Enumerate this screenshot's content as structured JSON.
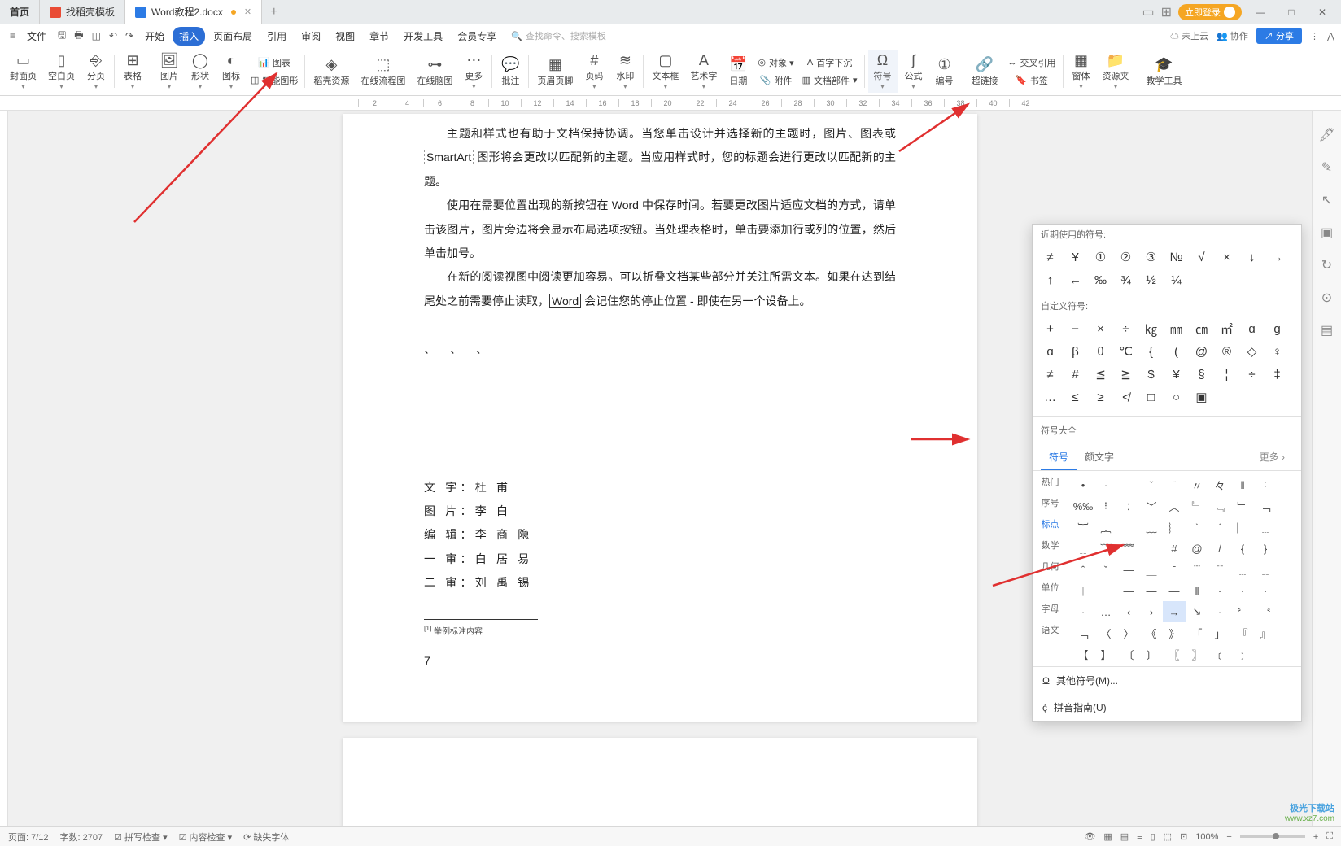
{
  "tabs": {
    "home": "首页",
    "template": "找稻壳模板",
    "doc": "Word教程2.docx"
  },
  "titlebar_right": {
    "login": "立即登录"
  },
  "menubar": {
    "file": "文件",
    "items": [
      "开始",
      "插入",
      "页面布局",
      "引用",
      "审阅",
      "视图",
      "章节",
      "开发工具",
      "会员专享"
    ],
    "search_placeholder": "查找命令、搜索模板",
    "right": {
      "cloud": "未上云",
      "collab": "协作",
      "share": "分享"
    }
  },
  "ribbon": {
    "items": [
      "封面页",
      "空白页",
      "分页",
      "表格",
      "图片",
      "形状",
      "图标",
      "智能图形",
      "稻壳资源",
      "在线流程图",
      "在线脑图",
      "更多",
      "批注",
      "页眉页脚",
      "页码",
      "水印",
      "文本框",
      "艺术字",
      "日期",
      "附件",
      "文档部件",
      "符号",
      "公式",
      "编号",
      "超链接",
      "窗体",
      "资源夹",
      "教学工具"
    ],
    "chart": "图表",
    "crossref": "交叉引用",
    "bookmark": "书签"
  },
  "document": {
    "p1": "主题和样式也有助于文档保持协调。当您单击设计并选择新的主题时，图片、图表或 ",
    "p1_box": "SmartArt",
    "p1_cont": " 图形将会更改以匹配新的主题。当应用样式时，您的标题会进行更改以匹配新的主题。",
    "p2": "使用在需要位置出现的新按钮在 Word 中保存时间。若要更改图片适应文档的方式，请单击该图片，图片旁边将会显示布局选项按钮。当处理表格时，单击要添加行或列的位置，然后单击加号。",
    "p3": "在新的阅读视图中阅读更加容易。可以折叠文档某些部分并关注所需文本。如果在达到结尾处之前需要停止读取，",
    "p3_box": "Word",
    "p3_cont": " 会记住您的停止位置 - 即使在另一个设备上。",
    "quotes": "、   、   、",
    "credits": [
      "文 字：杜   甫",
      "图 片：李   白",
      "编 辑：李 商 隐",
      "一 审：白 居 易",
      "二 审：刘 禹 锡"
    ],
    "footnote": "举例标注内容",
    "footnote_marker": "[1]",
    "page_num": "7"
  },
  "symbol_panel": {
    "recent_title": "近期使用的符号:",
    "recent": [
      "≠",
      "¥",
      "①",
      "②",
      "③",
      "№",
      "√",
      "×",
      "↓",
      "→",
      "↑",
      "←",
      "‰",
      "¾",
      "½",
      "¼"
    ],
    "custom_title": "自定义符号:",
    "custom": [
      "+",
      "−",
      "×",
      "÷",
      "㎏",
      "㎜",
      "㎝",
      "㎡",
      "ɑ",
      "ɡ",
      "ɑ",
      "β",
      "θ",
      "℃",
      "{",
      "(",
      "@",
      "®",
      "◇",
      "♀",
      "≠",
      "#",
      "≦",
      "≧",
      "$",
      "¥",
      "§",
      "¦",
      "÷",
      "‡",
      "…",
      "≤",
      "≥",
      "≮",
      "□",
      "○",
      "▣"
    ],
    "tab_symbol": "符号",
    "tab_face": "颜文字",
    "more": "更多",
    "categories": [
      "热门",
      "序号",
      "标点",
      "数学",
      "几何",
      "单位",
      "字母",
      "语文"
    ],
    "punctuation": [
      "•",
      "·",
      "ˉ",
      "ˇ",
      "¨",
      "〃",
      "々",
      "‖",
      "∶",
      "%‰",
      "⁝",
      "︰",
      "﹀",
      "︿",
      "﹄",
      "﹃",
      "﹂",
      "﹁",
      "︸",
      "︷",
      "",
      "﹏",
      "︴",
      "ˋ",
      "ˊ",
      "︳",
      "﹍",
      "﹎",
      "﹋",
      "﹌",
      "",
      "#",
      "@",
      "/",
      "{",
      "}",
      "ˆ",
      "ˇ",
      "—",
      "＿",
      "ˉ",
      "﹉",
      "﹊",
      "﹍",
      "﹎",
      "︱",
      "",
      "—",
      "—",
      "—",
      "‖",
      "·",
      "·",
      "·",
      "·",
      "…",
      "‹",
      "›",
      "→",
      "↘",
      "·",
      "〞",
      "〝",
      "﹁",
      "〈",
      "〉",
      "《",
      "》",
      "「",
      "」",
      "『",
      "』",
      "【",
      "】",
      "〔",
      "〕",
      "〖",
      "〗",
      "﹝",
      "﹞"
    ],
    "footer_other": "其他符号(M)...",
    "footer_pinyin": "拼音指南(U)"
  },
  "statusbar": {
    "page": "页面: 7/12",
    "words": "字数: 2707",
    "spell": "拼写检查",
    "doc_check": "内容检查",
    "missing_font": "缺失字体",
    "zoom": "100%"
  },
  "watermark": {
    "top": "极光下载站",
    "bot": "www.xz7.com"
  }
}
